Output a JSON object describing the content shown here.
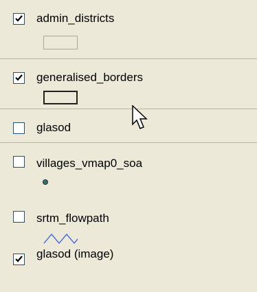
{
  "layers": [
    {
      "name": "admin_districts",
      "checked": true,
      "symbol": "polygon-light-icon"
    },
    {
      "name": "generalised_borders",
      "checked": true,
      "symbol": "polygon-dark-icon"
    },
    {
      "name": "glasod",
      "checked": false,
      "symbol": "none"
    },
    {
      "name": "villages_vmap0_soa",
      "checked": false,
      "symbol": "point-icon"
    },
    {
      "name": "srtm_flowpath",
      "checked": false,
      "symbol": "line-icon"
    },
    {
      "name": "glasod (image)",
      "checked": true,
      "symbol": "none"
    }
  ],
  "colors": {
    "panel_bg": "#ece9d8",
    "separator": "#b9b6a8",
    "checkbox_border": "#1c5180",
    "check_mark": "#000000",
    "point_fill": "#3b6b6b",
    "line_stroke": "#4a6fdc"
  },
  "cursor": "arrow-cursor-icon"
}
